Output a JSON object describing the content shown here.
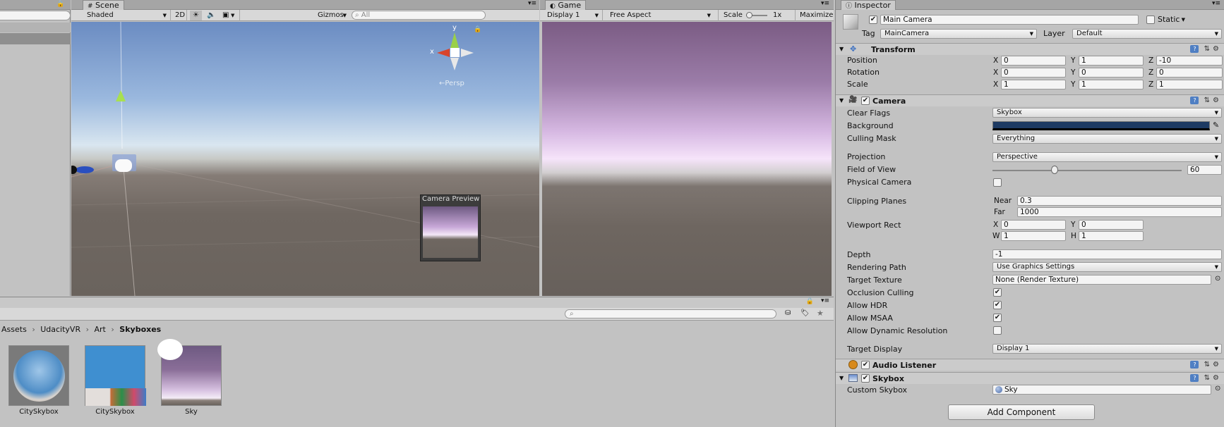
{
  "scene": {
    "tab_label": "Scene",
    "shading_mode": "Shaded",
    "mode_2d": "2D",
    "gizmos": "Gizmos",
    "search_placeholder": "All",
    "persp_label": "←Persp",
    "camera_preview_label": "Camera Preview",
    "gizmo_x": "x",
    "gizmo_y": "y"
  },
  "game": {
    "tab_label": "Game",
    "display": "Display 1",
    "aspect": "Free Aspect",
    "scale_label": "Scale",
    "scale_value": "1x",
    "maximize": "Maximize"
  },
  "project": {
    "breadcrumb": [
      "Assets",
      "UdacityVR",
      "Art",
      "Skyboxes"
    ],
    "assets": [
      {
        "name": "CitySkybox"
      },
      {
        "name": "CitySkybox"
      },
      {
        "name": "Sky"
      }
    ]
  },
  "inspector": {
    "tab_label": "Inspector",
    "object_name": "Main Camera",
    "static_label": "Static",
    "tag_label": "Tag",
    "tag_value": "MainCamera",
    "layer_label": "Layer",
    "layer_value": "Default",
    "transform": {
      "title": "Transform",
      "position_label": "Position",
      "rotation_label": "Rotation",
      "scale_label": "Scale",
      "position": {
        "x": "0",
        "y": "1",
        "z": "-10"
      },
      "rotation": {
        "x": "0",
        "y": "0",
        "z": "0"
      },
      "scale": {
        "x": "1",
        "y": "1",
        "z": "1"
      }
    },
    "camera": {
      "title": "Camera",
      "clear_flags_label": "Clear Flags",
      "clear_flags": "Skybox",
      "background_label": "Background",
      "background_color": "#1d3a63",
      "culling_mask_label": "Culling Mask",
      "culling_mask": "Everything",
      "projection_label": "Projection",
      "projection": "Perspective",
      "fov_label": "Field of View",
      "fov": "60",
      "fov_fraction": 0.33,
      "physical_label": "Physical Camera",
      "clipping_label": "Clipping Planes",
      "near_label": "Near",
      "near": "0.3",
      "far_label": "Far",
      "far": "1000",
      "viewport_label": "Viewport Rect",
      "viewport": {
        "x": "0",
        "y": "0",
        "w": "1",
        "h": "1"
      },
      "depth_label": "Depth",
      "depth": "-1",
      "rendering_path_label": "Rendering Path",
      "rendering_path": "Use Graphics Settings",
      "target_texture_label": "Target Texture",
      "target_texture": "None (Render Texture)",
      "occlusion_label": "Occlusion Culling",
      "hdr_label": "Allow HDR",
      "msaa_label": "Allow MSAA",
      "dynres_label": "Allow Dynamic Resolution",
      "target_display_label": "Target Display",
      "target_display": "Display 1"
    },
    "audio_listener": {
      "title": "Audio Listener"
    },
    "skybox": {
      "title": "Skybox",
      "custom_label": "Custom Skybox",
      "custom_value": "Sky"
    },
    "add_component": "Add Component"
  },
  "labels": {
    "x": "X",
    "y": "Y",
    "z": "Z",
    "w": "W",
    "h": "H",
    "check": "✔"
  },
  "colors": {
    "accent_blue": "#4f7fc3",
    "sky_top": "#6f8fc4",
    "ground": "#6e6660",
    "game_sky": "#7b5c84"
  }
}
